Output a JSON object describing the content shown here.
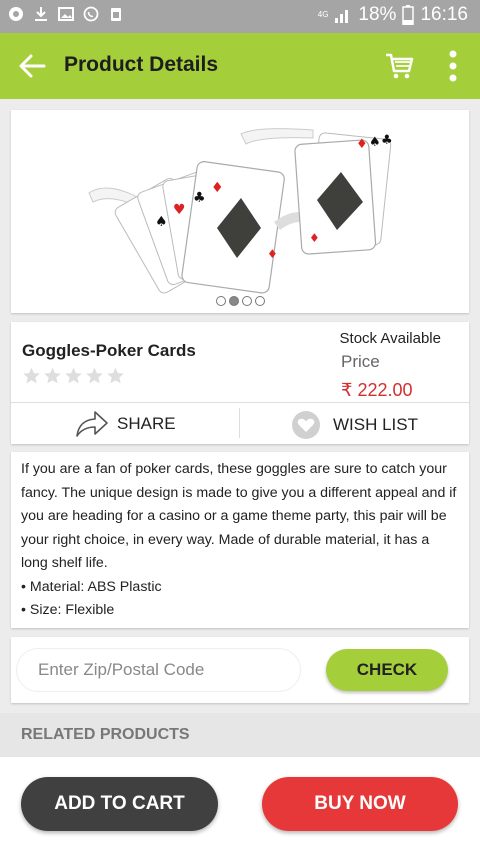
{
  "status_bar": {
    "network": "4G",
    "battery": "18%",
    "time": "16:16",
    "icons": [
      "chrome-icon",
      "download-icon",
      "gallery-icon",
      "whatsapp-icon",
      "clipboard-icon",
      "signal-icon",
      "battery-icon"
    ]
  },
  "header": {
    "title": "Product Details",
    "back_icon": "back-arrow-icon",
    "cart_icon": "cart-icon",
    "menu_icon": "more-vert-icon",
    "color": "#a4cf3b"
  },
  "gallery": {
    "image": "poker-card-goggles",
    "image_count": 4,
    "active_index": 1
  },
  "product": {
    "name": "Goggles-Poker Cards",
    "rating": 0,
    "rating_max": 5,
    "stock": "Stock Available",
    "price_label": "Price",
    "price": "₹ 222.00",
    "price_color": "#d32f2f"
  },
  "actions": {
    "share": "SHARE",
    "wishlist": "WISH LIST"
  },
  "description": {
    "text": "If you are a fan of poker cards, these goggles are sure to catch your fancy. The unique design is made to give you a different appeal and if you are heading for a casino or a game theme party, this pair will be your right choice, in every way. Made of durable material, it has a long shelf life.",
    "bullets": [
      "Material: ABS Plastic",
      "Size: Flexible"
    ]
  },
  "zip": {
    "placeholder": "Enter Zip/Postal Code",
    "value": "",
    "button": "CHECK"
  },
  "related": {
    "heading": "RELATED PRODUCTS"
  },
  "bottom": {
    "add_to_cart": "ADD TO CART",
    "buy_now": "BUY NOW",
    "add_color": "#404040",
    "buy_color": "#e63838"
  }
}
